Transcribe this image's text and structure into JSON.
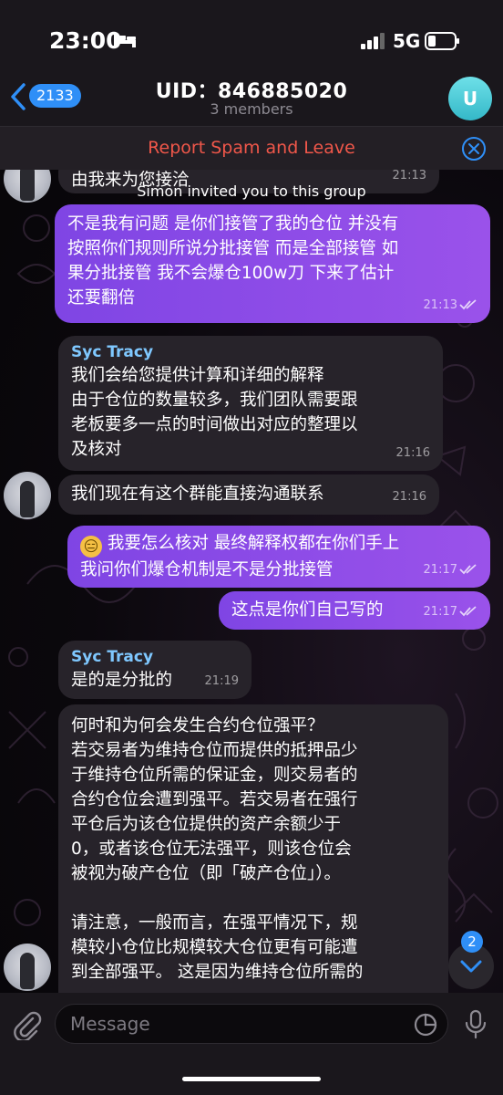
{
  "status_bar": {
    "time": "23:00",
    "network": "5G"
  },
  "header": {
    "back_count": "2133",
    "title": "UID：846885020",
    "subtitle": "3 members",
    "avatar_letter": "U"
  },
  "spam_bar": {
    "text": "Report Spam and Leave"
  },
  "messages": [
    {
      "text": "由我来为您接洽",
      "time": "21:13"
    },
    {
      "service": "Simon invited you to this group"
    },
    {
      "text": "不是我有问题 是你们接管了我的仓位 并没有按照你们规则所说分批接管 而是全部接管 如果分批接管 我不会爆仓100w刀 下来了估计还要翻倍",
      "time": "21:13"
    },
    {
      "sender": "Syc Tracy",
      "text": "我们会给您提供计算和详细的解释 由于仓位的数量较多，我们团队需要跟老板要多一点的时间做出对应的整理以及核对",
      "time": "21:16"
    },
    {
      "text": "我们现在有这个群能直接沟通联系",
      "time": "21:16"
    },
    {
      "emoji": "😑",
      "text": "我要怎么核对 最终解释权都在你们手上 我问你们爆仓机制是不是分批接管",
      "time": "21:17"
    },
    {
      "text": "这点是你们自己写的",
      "time": "21:17"
    },
    {
      "sender": "Syc Tracy",
      "text": "是的是分批的",
      "time": "21:19"
    },
    {
      "text": "何时和为何会发生合约仓位强平？若交易者为维持仓位而提供的抵押品少于维持仓位所需的保证金，则交易者的合约仓位会遭到强平。若交易者在强行平仓后为该仓位提供的资产余额少于0，或者该仓位无法强平，则该仓位会被视为破产仓位（即「破产仓位」）。",
      "text2": "请注意，一般而言，在强平情况下，规模较小仓位比规模较大仓位更有可能遭到全部强平。 这是因为维持仓位所需的"
    }
  ],
  "lines": {
    "m0": [
      "由我来为您接洽"
    ],
    "m2": [
      "不是我有问题 是你们接管了我的仓位 并没有",
      "按照你们规则所说分批接管 而是全部接管 如",
      "果分批接管 我不会爆仓100w刀 下来了估计",
      "还要翻倍"
    ],
    "m3": [
      "我们会给您提供计算和详细的解释",
      "由于仓位的数量较多，我们团队需要跟",
      "老板要多一点的时间做出对应的整理以",
      "及核对"
    ],
    "m5": [
      "我要怎么核对 最终解释权都在你们手上",
      "我问你们爆仓机制是不是分批接管"
    ],
    "m8a": [
      "何时和为何会发生合约仓位强平？",
      "若交易者为维持仓位而提供的抵押品少",
      "于维持仓位所需的保证金，则交易者的",
      "合约仓位会遭到强平。若交易者在强行",
      "平仓后为该仓位提供的资产余额少于",
      "0，或者该仓位无法强平，则该仓位会",
      "被视为破产仓位（即「破产仓位」）。"
    ],
    "m8b": [
      "请注意，一般而言，在强平情况下，规",
      "模较小仓位比规模较大仓位更有可能遭",
      "到全部强平。 这是因为维持仓位所需的"
    ]
  },
  "scroll_fab": {
    "unread": "2"
  },
  "input": {
    "placeholder": "Message"
  },
  "icons": [
    "bed-icon",
    "signal-icon",
    "battery-icon",
    "chevron-left-icon",
    "close-circle-icon",
    "read-checks-icon",
    "chevron-down-icon",
    "paperclip-icon",
    "sticker-icon",
    "microphone-icon"
  ],
  "colors": {
    "accent": "#2f8ff7",
    "outgoing": "#8a4ce8",
    "incoming": "#27232a",
    "spam": "#f0574a",
    "sender": "#7fc8ff"
  }
}
